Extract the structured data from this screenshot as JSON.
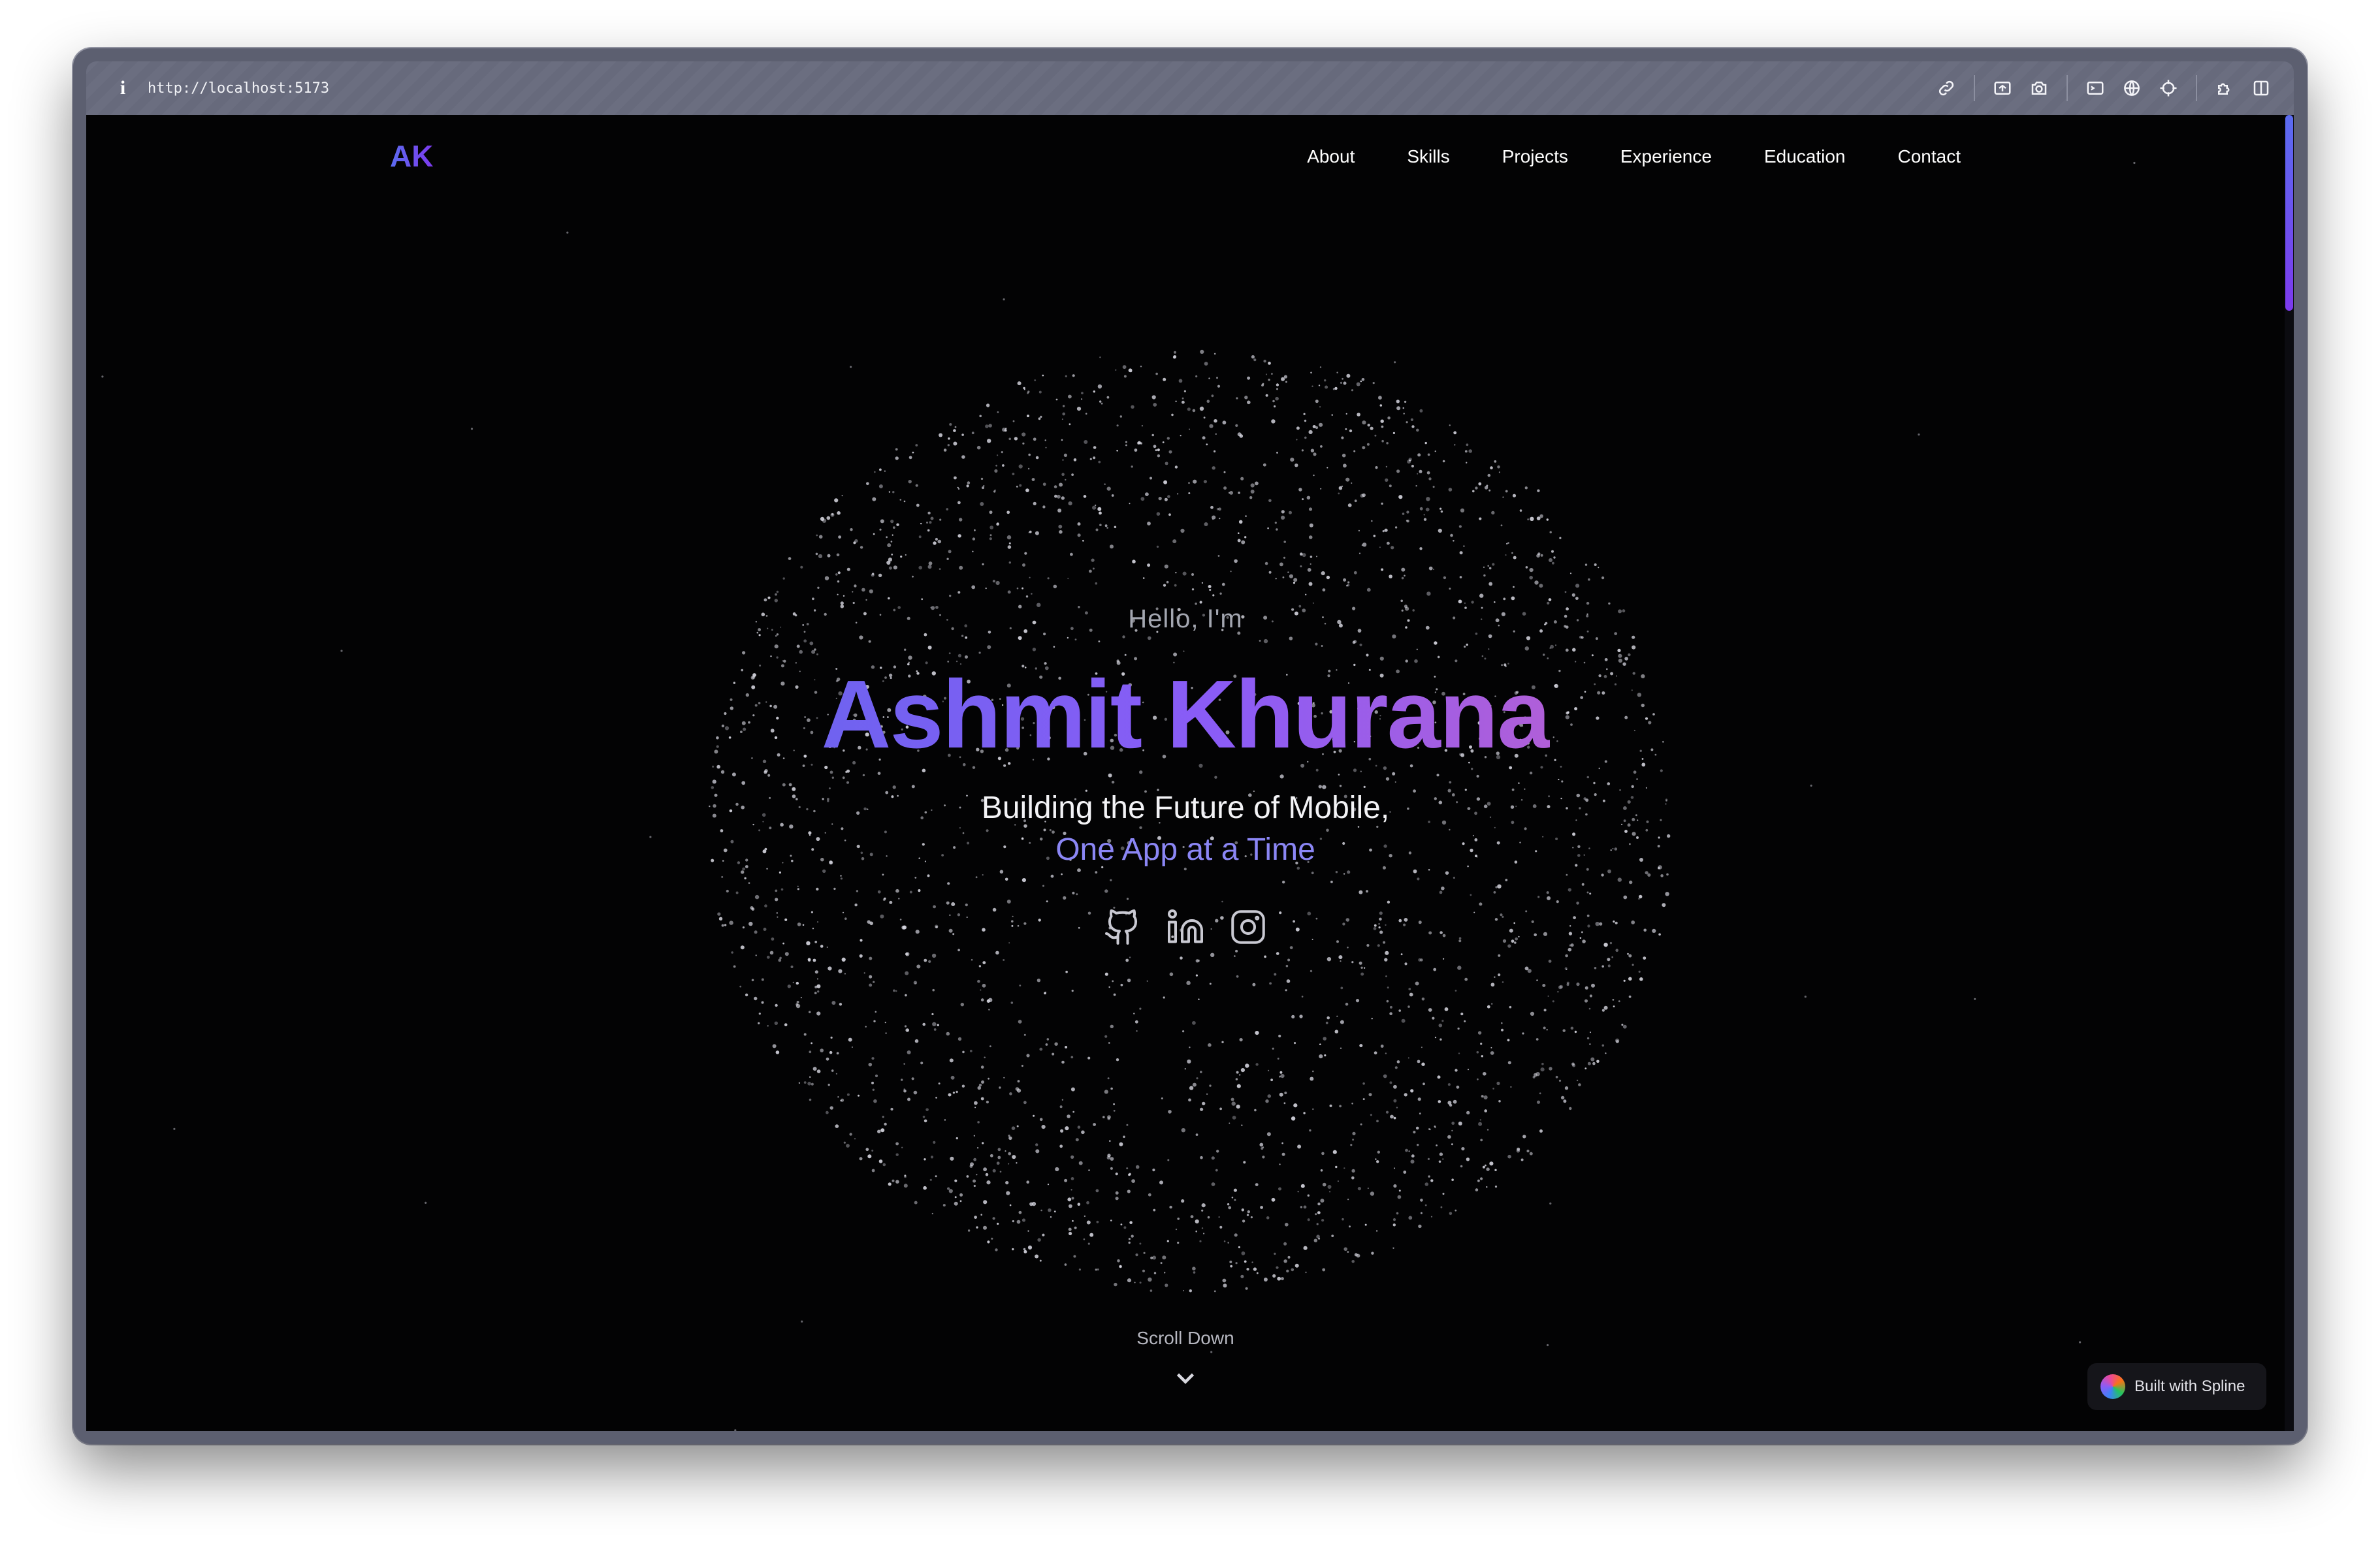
{
  "browser": {
    "url": "http://localhost:5173",
    "toolbar_icons": [
      "link-icon",
      "screenshot-icon",
      "camera-icon",
      "terminal-icon",
      "globe-icon",
      "crosshair-icon",
      "extension-icon",
      "sidebar-icon"
    ]
  },
  "nav": {
    "logo": "AK",
    "links": [
      "About",
      "Skills",
      "Projects",
      "Experience",
      "Education",
      "Contact"
    ]
  },
  "hero": {
    "greeting": "Hello, I'm",
    "name": "Ashmit Khurana",
    "tagline_line1": "Building the Future of Mobile,",
    "tagline_line2": "One App at a Time",
    "socials": [
      "github-icon",
      "linkedin-icon",
      "instagram-icon"
    ]
  },
  "scroll": {
    "label": "Scroll Down"
  },
  "badge": {
    "label": "Built with Spline"
  },
  "colors": {
    "background": "#030304",
    "accent_start": "#6f62f0",
    "accent_end": "#b05fd8",
    "tagline_accent": "#8b86f5"
  }
}
